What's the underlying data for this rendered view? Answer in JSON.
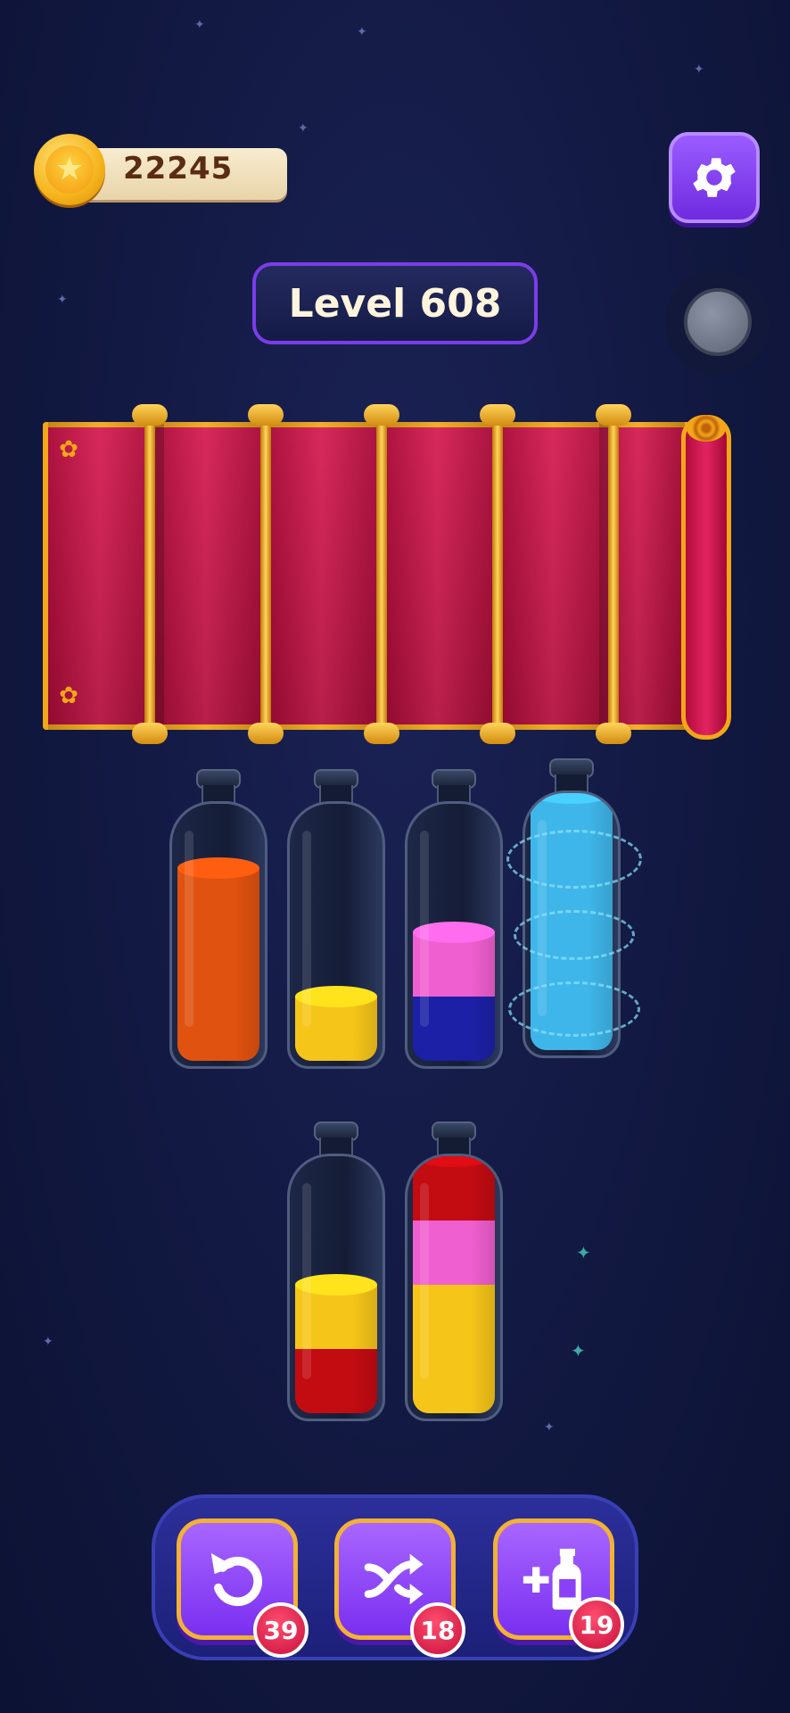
{
  "hud": {
    "coins": "22245",
    "level": "Level 608",
    "coin_icon": "star-coin-icon",
    "settings_icon": "gear-icon"
  },
  "colors": {
    "orange": "#e0520f",
    "yellow": "#f6c519",
    "pink": "#f05fcf",
    "navy": "#1c20a6",
    "cyan": "#3fb6ea",
    "red": "#c30b12",
    "curtain_red": "#c8104a",
    "gold": "#f2a718"
  },
  "board": {
    "bottle_capacity": 4,
    "bottles": [
      {
        "layers": [
          {
            "color": "orange",
            "units": 3
          }
        ]
      },
      {
        "layers": [
          {
            "color": "yellow",
            "units": 1
          }
        ]
      },
      {
        "layers": [
          {
            "color": "navy",
            "units": 1
          },
          {
            "color": "pink",
            "units": 1
          }
        ]
      },
      {
        "layers": [
          {
            "color": "cyan",
            "units": 4
          }
        ],
        "completed": true
      },
      {
        "layers": [
          {
            "color": "red",
            "units": 1
          },
          {
            "color": "yellow",
            "units": 1
          }
        ]
      },
      {
        "layers": [
          {
            "color": "yellow",
            "units": 2
          },
          {
            "color": "pink",
            "units": 1
          },
          {
            "color": "red",
            "units": 1
          }
        ]
      }
    ]
  },
  "boosters": [
    {
      "name": "undo",
      "icon": "undo-icon",
      "count": "39"
    },
    {
      "name": "shuffle",
      "icon": "shuffle-icon",
      "count": "18"
    },
    {
      "name": "add-bottle",
      "icon": "add-bottle-icon",
      "count": "19"
    }
  ]
}
